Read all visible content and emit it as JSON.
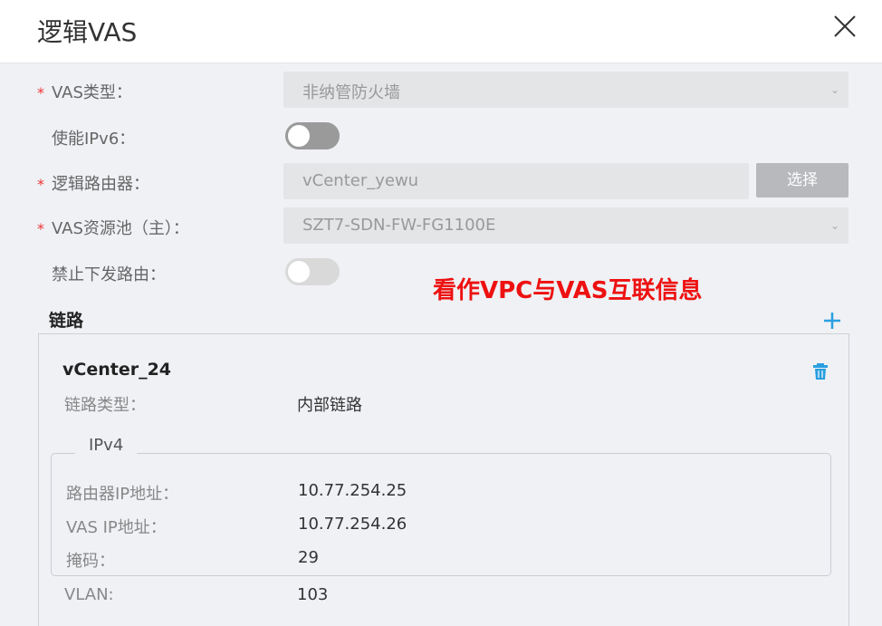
{
  "dialog": {
    "title": "逻辑VAS"
  },
  "form": {
    "vas_type": {
      "label": "VAS类型：",
      "value": "非纳管防火墙"
    },
    "ipv6": {
      "label": "使能IPv6：",
      "enabled": false
    },
    "logical_router": {
      "label": "逻辑路由器：",
      "value": "vCenter_yewu",
      "button": "选择"
    },
    "vas_pool": {
      "label": "VAS资源池（主）：",
      "value": "SZT7-SDN-FW-FG1100E"
    },
    "forbid_route": {
      "label": "禁止下发路由：",
      "enabled": false
    },
    "required_mark": "*"
  },
  "annotation": "看作VPC与VAS互联信息",
  "links": {
    "section_title": "链路",
    "add_icon": "plus-icon",
    "item": {
      "name": "vCenter_24",
      "delete_icon": "trash-icon",
      "type_label": "链路类型：",
      "type_value": "内部链路",
      "ipv4": {
        "legend": "IPv4",
        "router_ip_label": "路由器IP地址：",
        "router_ip_value": "10.77.254.25",
        "vas_ip_label": "VAS IP地址：",
        "vas_ip_value": "10.77.254.26",
        "mask_label": "掩码：",
        "mask_value": "29"
      },
      "vlan_label": "VLAN:",
      "vlan_value": "103"
    }
  },
  "colors": {
    "required": "#ee3333",
    "annotation": "#ee1111",
    "toggle_on_track": "#9a9a9a",
    "toggle_off_track": "#d9d9d9",
    "icon_blue": "#2a9fe0"
  }
}
